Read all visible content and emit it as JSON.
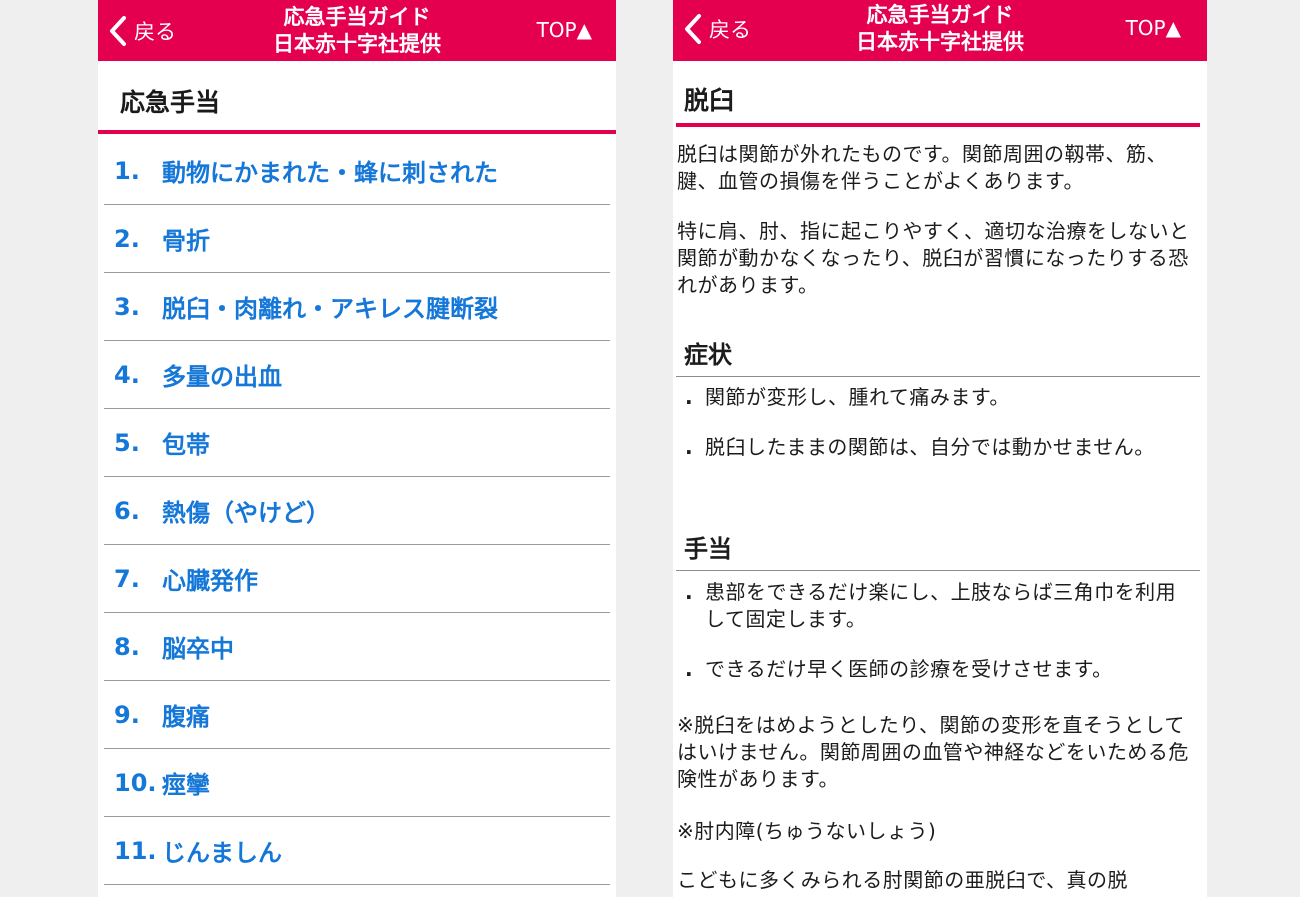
{
  "left": {
    "nav": {
      "back_label": "戻る",
      "title_line1": "応急手当ガイド",
      "title_line2": "日本赤十字社提供",
      "top_label": "TOP▲"
    },
    "section_title": "応急手当",
    "items": [
      {
        "num": "1.",
        "label": "動物にかまれた・蜂に刺された"
      },
      {
        "num": "2.",
        "label": "骨折"
      },
      {
        "num": "3.",
        "label": "脱臼・肉離れ・アキレス腱断裂"
      },
      {
        "num": "4.",
        "label": "多量の出血"
      },
      {
        "num": "5.",
        "label": "包帯"
      },
      {
        "num": "6.",
        "label": "熱傷（やけど）"
      },
      {
        "num": "7.",
        "label": "心臓発作"
      },
      {
        "num": "8.",
        "label": "脳卒中"
      },
      {
        "num": "9.",
        "label": "腹痛"
      },
      {
        "num": "10.",
        "label": "痙攣"
      },
      {
        "num": "11.",
        "label": "じんましん"
      }
    ]
  },
  "right": {
    "nav": {
      "back_label": "戻る",
      "title_line1": "応急手当ガイド",
      "title_line2": "日本赤十字社提供",
      "top_label": "TOP▲"
    },
    "article": {
      "title": "脱臼",
      "intro1": " 脱臼は関節が外れたものです。関節周囲の靱帯、筋、腱、血管の損傷を伴うことがよくあります。",
      "intro2": " 特に肩、肘、指に起こりやすく、適切な治療をしないと関節が動かなくなったり、脱臼が習慣になったりする恐れがあります。",
      "symptoms_heading": "症状",
      "symptoms": [
        "関節が変形し、腫れて痛みます。",
        "脱臼したままの関節は、自分では動かせません。"
      ],
      "treatment_heading": "手当",
      "treatments": [
        "患部をできるだけ楽にし、上肢ならば三角巾を利用して固定します。",
        "できるだけ早く医師の診療を受けさせます。"
      ],
      "note1": "※脱臼をはめようとしたり、関節の変形を直そうとしてはいけません。関節周囲の血管や神経などをいためる危険性があります。",
      "note2_heading": "※肘内障(ちゅうないしょう)",
      "note2_text": "こどもに多くみられる肘関節の亜脱臼で、真の脱"
    }
  }
}
